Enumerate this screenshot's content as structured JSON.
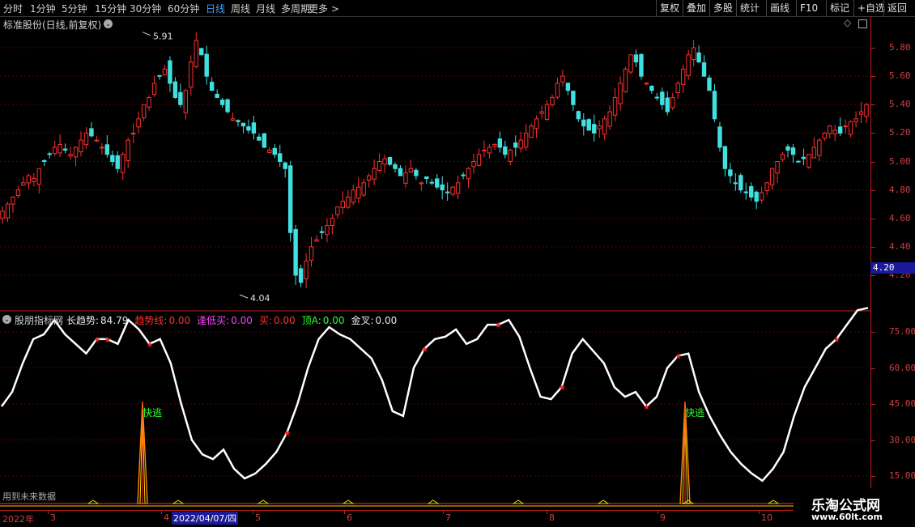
{
  "toolbar": {
    "periods": [
      "分时",
      "1分钟",
      "5分钟",
      "15分钟",
      "30分钟",
      "60分钟",
      "日线",
      "周线",
      "月线",
      "多周期",
      "更多 >"
    ],
    "active_period": "日线",
    "buttons": [
      "复权",
      "叠加",
      "多股",
      "统计",
      "画线",
      "F10",
      "标记",
      "+自选",
      "返回"
    ]
  },
  "main_title": "标准股份(日线,前复权)",
  "price_axis": {
    "ticks": [
      "5.80",
      "5.60",
      "5.40",
      "5.20",
      "5.00",
      "4.80",
      "4.60",
      "4.40",
      "4.20"
    ],
    "current": "4.20"
  },
  "price_annotations": {
    "high": "5.91",
    "low": "4.04"
  },
  "indicator_bar": {
    "name": "股朋指标网",
    "items": [
      {
        "label": "长趋势:",
        "value": "84.79",
        "color": "#e8e8e8"
      },
      {
        "label": "趋势线:",
        "value": "0.00",
        "color": "#ff3030"
      },
      {
        "label": "逢低买:",
        "value": "0.00",
        "color": "#ff40ff"
      },
      {
        "label": "买:",
        "value": "0.00",
        "color": "#ff3030"
      },
      {
        "label": "顶A:",
        "value": "0.00",
        "color": "#30ff30"
      },
      {
        "label": "金叉:",
        "value": "0.00",
        "color": "#e8e8e8"
      }
    ]
  },
  "indicator_axis": {
    "ticks": [
      "75.00",
      "60.00",
      "45.00",
      "30.00",
      "15.00"
    ]
  },
  "signal_text": "快逃",
  "future_data_text": "用到未来数据",
  "date_axis": {
    "year": "2022年",
    "months": [
      "3",
      "4",
      "5",
      "6",
      "7",
      "8",
      "9",
      "10"
    ],
    "cursor_date": "2022/04/07/四"
  },
  "watermark": {
    "line1": "乐淘公式网",
    "line2": "www.60lt.com"
  },
  "colors": {
    "up": "#ff3030",
    "down": "#40e0e0",
    "axis": "#c02020",
    "accent": "#3ca0ff"
  },
  "chart_data": [
    {
      "type": "candlestick",
      "title": "标准股份(日线,前复权)",
      "ylim": [
        4.0,
        5.95
      ],
      "close_series": [
        4.65,
        4.7,
        4.75,
        4.8,
        4.85,
        4.9,
        4.88,
        4.95,
        5.0,
        5.05,
        5.1,
        5.12,
        5.08,
        5.05,
        5.1,
        5.15,
        5.2,
        5.18,
        5.15,
        5.1,
        5.05,
        5.0,
        4.95,
        5.05,
        5.15,
        5.2,
        5.3,
        5.4,
        5.45,
        5.55,
        5.6,
        5.65,
        5.55,
        5.45,
        5.4,
        5.5,
        5.7,
        5.85,
        5.75,
        5.6,
        5.5,
        5.45,
        5.4,
        5.35,
        5.3,
        5.28,
        5.25,
        5.22,
        5.2,
        5.15,
        5.1,
        5.08,
        5.05,
        5.0,
        4.95,
        4.5,
        4.2,
        4.15,
        4.3,
        4.4,
        4.45,
        4.5,
        4.55,
        4.6,
        4.68,
        4.72,
        4.75,
        4.8,
        4.82,
        4.85,
        4.9,
        4.95,
        5.0,
        5.02,
        4.98,
        4.95,
        4.9,
        4.92,
        4.95,
        4.9,
        4.85,
        4.88,
        4.85,
        4.82,
        4.8,
        4.78,
        4.82,
        4.85,
        4.9,
        4.95,
        5.0,
        5.05,
        5.08,
        5.1,
        5.12,
        5.1,
        5.05,
        5.08,
        5.1,
        5.15,
        5.2,
        5.25,
        5.3,
        5.35,
        5.4,
        5.45,
        5.55,
        5.6,
        5.5,
        5.4,
        5.3,
        5.25,
        5.22,
        5.2,
        5.25,
        5.3,
        5.35,
        5.45,
        5.55,
        5.65,
        5.75,
        5.7,
        5.6,
        5.55,
        5.5,
        5.45,
        5.4,
        5.35,
        5.45,
        5.55,
        5.65,
        5.75,
        5.8,
        5.7,
        5.6,
        5.5,
        5.3,
        5.1,
        4.95,
        4.9,
        4.85,
        4.8,
        4.78,
        4.75,
        4.72,
        4.78,
        4.85,
        4.95,
        5.0,
        5.05,
        5.08,
        5.05,
        5.0,
        5.02,
        5.05,
        5.1,
        5.15,
        5.2,
        5.25,
        5.22,
        5.2,
        5.25,
        5.28,
        5.3,
        5.35,
        5.4
      ],
      "high": 5.91,
      "low": 4.04
    },
    {
      "type": "line",
      "series": [
        {
          "name": "长趋势",
          "values": [
            44,
            50,
            62,
            72,
            74,
            80,
            74,
            70,
            66,
            72,
            72,
            70,
            80,
            76,
            70,
            72,
            62,
            45,
            30,
            24,
            22,
            26,
            18,
            14,
            16,
            20,
            25,
            33,
            45,
            60,
            72,
            77,
            74,
            72,
            68,
            64,
            55,
            42,
            40,
            60,
            68,
            72,
            73,
            76,
            70,
            72,
            78,
            78,
            80,
            73,
            60,
            48,
            47,
            52,
            66,
            72,
            67,
            62,
            52,
            48,
            50,
            44,
            48,
            60,
            65,
            66,
            50,
            40,
            32,
            25,
            20,
            16,
            13,
            18,
            25,
            40,
            52,
            60,
            68,
            72,
            78,
            84,
            85
          ]
        }
      ],
      "markers": "red stars at buy points",
      "signals": [
        "快逃",
        "快逃"
      ],
      "ylim": [
        10,
        88
      ]
    }
  ]
}
